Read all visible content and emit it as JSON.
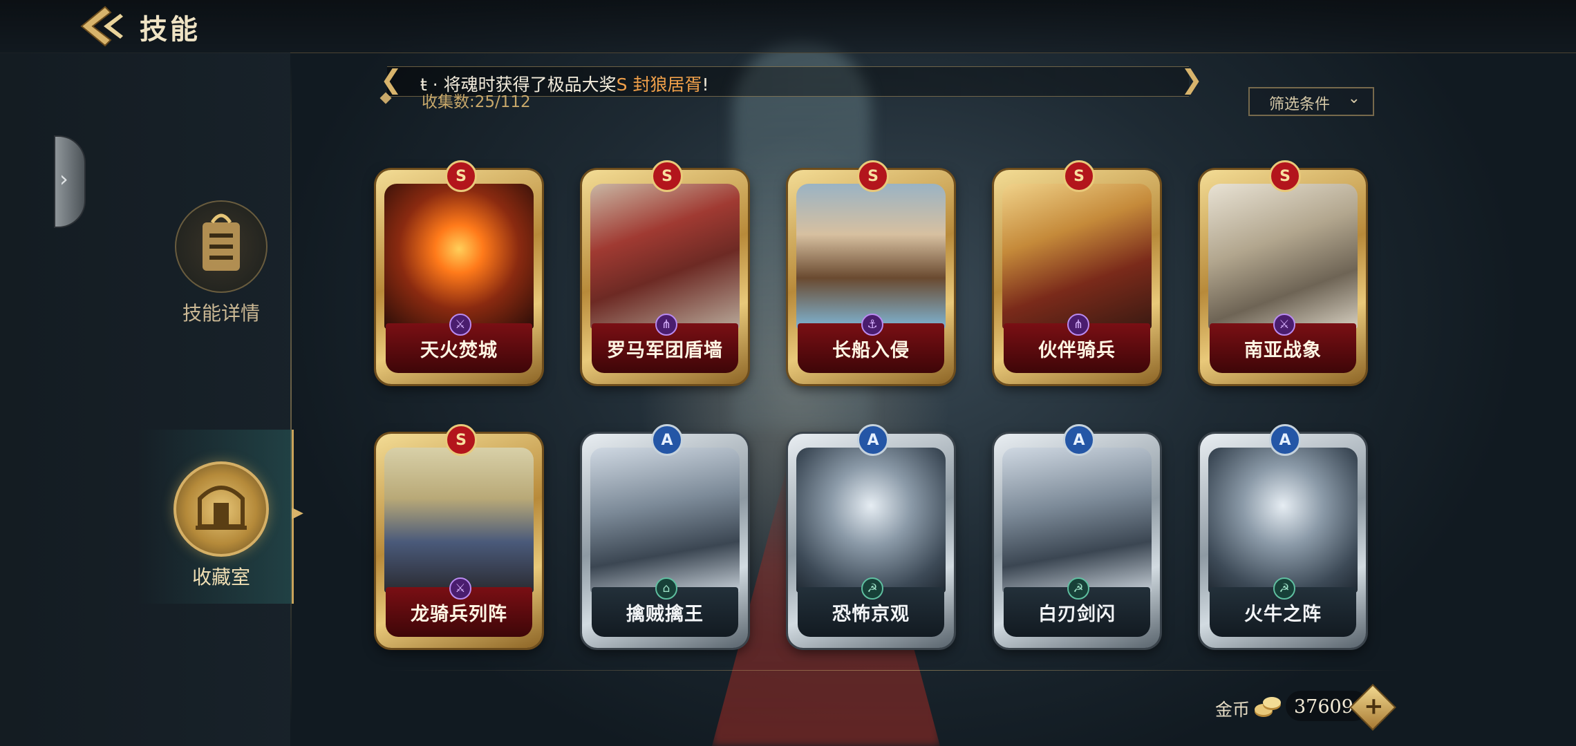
{
  "header": {
    "title": "技能",
    "back_icon": "back-arrow-icon"
  },
  "sidebar": {
    "collapse_icon": "chevron-right-icon",
    "items": [
      {
        "label": "技能详情",
        "icon": "skill-detail-icon",
        "active": false
      },
      {
        "label": "收藏室",
        "icon": "collection-room-icon",
        "active": true
      }
    ]
  },
  "ticker": {
    "text_prefix": "ŧ · 将魂时获得了极品大奖",
    "highlight": "S 封狼居胥",
    "text_suffix": "!"
  },
  "collection": {
    "count_label": "收集数:25/112"
  },
  "filter": {
    "label": "筛选条件"
  },
  "cards": [
    {
      "name": "天火焚城",
      "tier": "S",
      "art": "fire-city"
    },
    {
      "name": "罗马军团盾墙",
      "tier": "S",
      "art": "roman-legion"
    },
    {
      "name": "长船入侵",
      "tier": "S",
      "art": "longship"
    },
    {
      "name": "伙伴骑兵",
      "tier": "S",
      "art": "companion-cavalry"
    },
    {
      "name": "南亚战象",
      "tier": "S",
      "art": "war-elephant"
    },
    {
      "name": "龙骑兵列阵",
      "tier": "S",
      "art": "dragoon"
    },
    {
      "name": "擒贼擒王",
      "tier": "A",
      "art": "chariot"
    },
    {
      "name": "恐怖京观",
      "tier": "A",
      "art": "crossed-axes"
    },
    {
      "name": "白刃剑闪",
      "tier": "A",
      "art": "chariot"
    },
    {
      "name": "火牛之阵",
      "tier": "A",
      "art": "crossed-axes"
    }
  ],
  "currency": {
    "label": "金币",
    "value": "37609",
    "icon": "gold-coins-icon",
    "add_icon": "plus-icon"
  },
  "colors": {
    "accent_gold": "#c9a35a",
    "s_tier_red": "#7a0f14",
    "a_tier_blue": "#2456a6",
    "highlight_orange": "#f0a04a"
  }
}
